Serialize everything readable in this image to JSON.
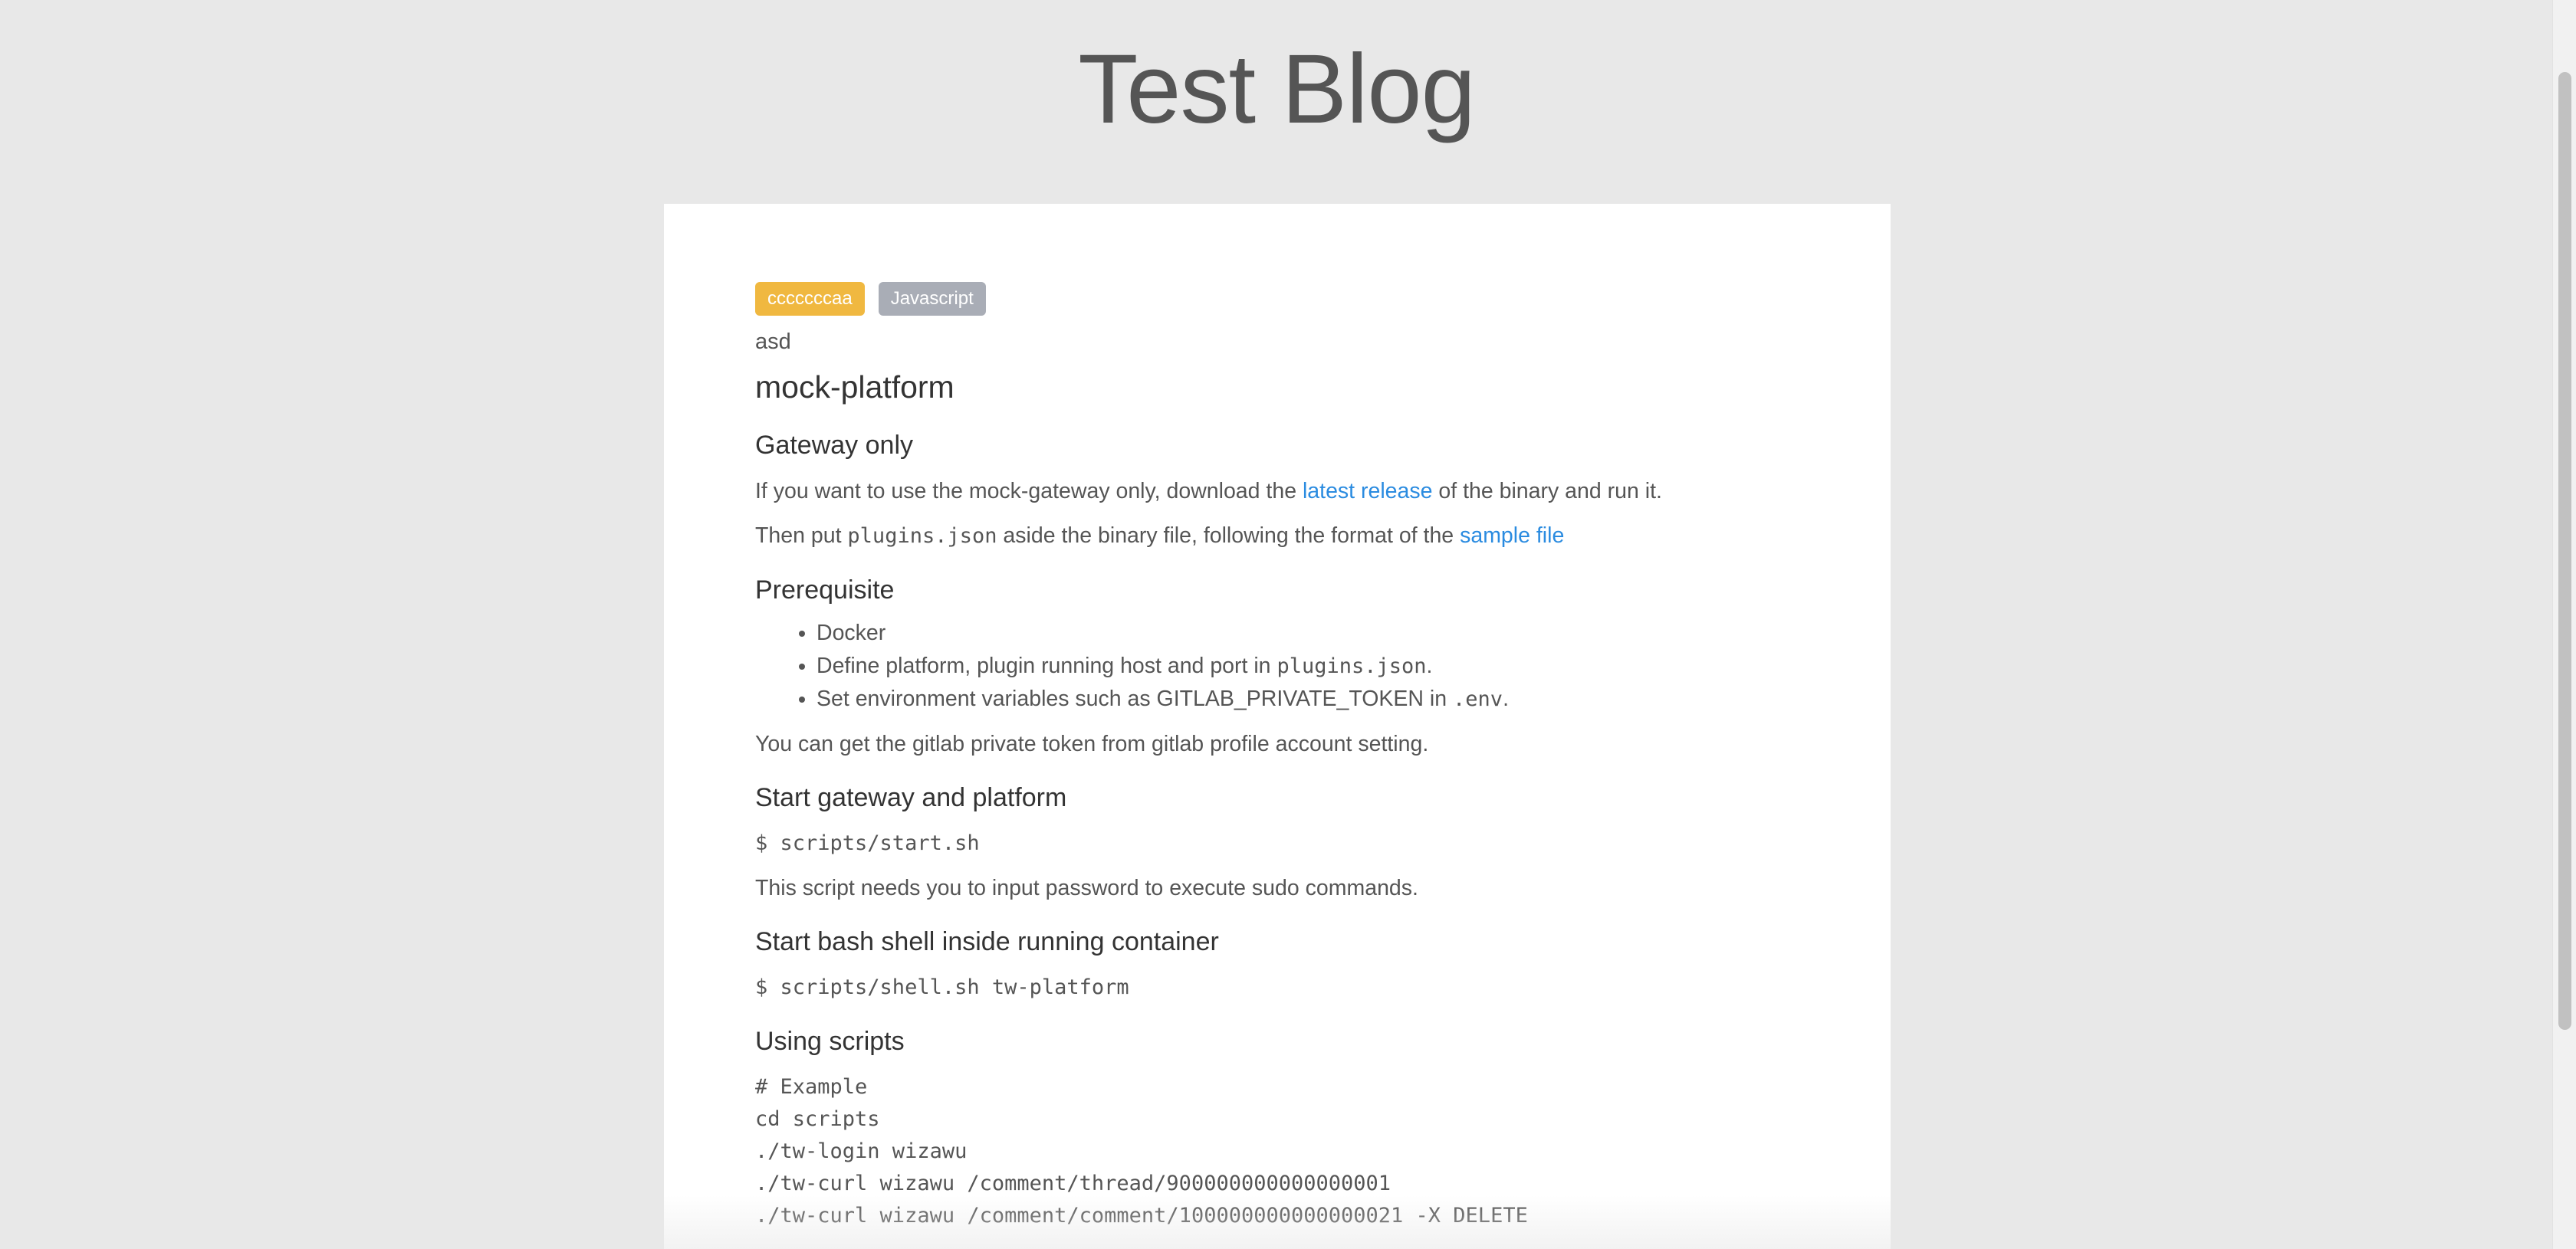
{
  "site": {
    "title": "Test Blog"
  },
  "post": {
    "tags": [
      {
        "label": "cccccccaa",
        "color": "#f0b840"
      },
      {
        "label": "Javascript",
        "color": "#a9adb6"
      }
    ],
    "subtitle": "asd",
    "title": "mock-platform",
    "sections": {
      "gateway": {
        "heading": "Gateway only",
        "p1_before": "If you want to use the mock-gateway only, download the ",
        "p1_link": "latest release",
        "p1_after": " of the binary and run it.",
        "p2_before": "Then put ",
        "p2_code": "plugins.json",
        "p2_middle": " aside the binary file, following the format of the ",
        "p2_link": "sample file"
      },
      "prereq": {
        "heading": "Prerequisite",
        "item1": "Docker",
        "item2_before": "Define platform, plugin running host and port in ",
        "item2_code": "plugins.json",
        "item2_after": ".",
        "item3_before": "Set environment variables such as GITLAB_PRIVATE_TOKEN in ",
        "item3_code": ".env",
        "item3_after": ".",
        "note": "You can get the gitlab private token from gitlab profile account setting."
      },
      "start": {
        "heading": "Start gateway and platform",
        "code": "$ scripts/start.sh",
        "note": "This script needs you to input password to execute sudo commands."
      },
      "shell": {
        "heading": "Start bash shell inside running container",
        "code": "$ scripts/shell.sh tw-platform"
      },
      "scripts": {
        "heading": "Using scripts",
        "code_lines": [
          "# Example",
          "cd scripts",
          "./tw-login wizawu",
          "./tw-curl wizawu /comment/thread/900000000000000001",
          "./tw-curl wizawu /comment/comment/100000000000000021 -X DELETE"
        ]
      }
    }
  },
  "colors": {
    "background": "#e8e8e8",
    "card": "#ffffff",
    "link": "#2a8be0",
    "text": "#555555",
    "heading": "#333333"
  }
}
